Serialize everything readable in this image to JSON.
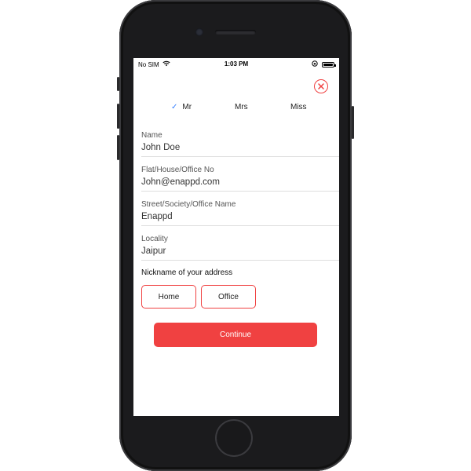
{
  "status_bar": {
    "carrier": "No SIM",
    "time": "1:03 PM",
    "wifi_icon": "wifi-icon",
    "orientation_lock_icon": "orientation-lock-icon",
    "battery_icon": "battery-icon"
  },
  "close_icon": "close-circle-icon",
  "accent_color": "#f04141",
  "check_color": "#3880ff",
  "titles": {
    "selected": "Mr",
    "options": [
      "Mr",
      "Mrs",
      "Miss"
    ]
  },
  "form": {
    "fields": [
      {
        "label": "Name",
        "value": "John Doe"
      },
      {
        "label": "Flat/House/Office No",
        "value": "John@enappd.com"
      },
      {
        "label": "Street/Society/Office Name",
        "value": "Enappd"
      },
      {
        "label": "Locality",
        "value": "Jaipur"
      }
    ]
  },
  "nickname": {
    "label": "Nickname of your address",
    "options": [
      "Home",
      "Office"
    ]
  },
  "continue_label": "Continue"
}
